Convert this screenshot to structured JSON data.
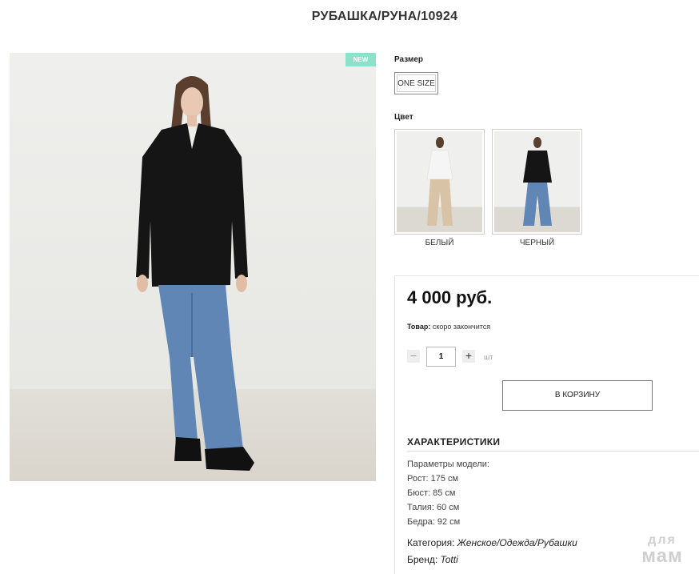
{
  "product": {
    "title": "РУБАШКА/РУНА/10924",
    "badge": "NEW"
  },
  "size": {
    "label": "Размер",
    "option": "ONE SIZE"
  },
  "color": {
    "label": "Цвет",
    "options": [
      {
        "label": "БЕЛЫЙ"
      },
      {
        "label": "ЧЕРНЫЙ"
      }
    ]
  },
  "buy": {
    "price": "4 000 руб.",
    "stock_label": "Товар:",
    "stock_value": "скоро закончится",
    "quantity": "1",
    "minus": "−",
    "plus": "+",
    "unit": "шт",
    "cart_button": "В КОРЗИНУ"
  },
  "characteristics": {
    "title": "ХАРАКТЕРИСТИКИ",
    "params_heading": "Параметры модели:",
    "params": [
      "Рост: 175 см",
      "Бюст: 85 см",
      "Талия: 60 см",
      "Бедра: 92 см"
    ],
    "category_label": "Категория:",
    "category_value": "Женское/Одежда/Рубашки",
    "brand_label": "Бренд:",
    "brand_value": "Totti"
  },
  "watermark": {
    "line1": "для",
    "line2": "мам"
  },
  "colors": {
    "badge": "#8fe0c9",
    "border": "#777777"
  }
}
